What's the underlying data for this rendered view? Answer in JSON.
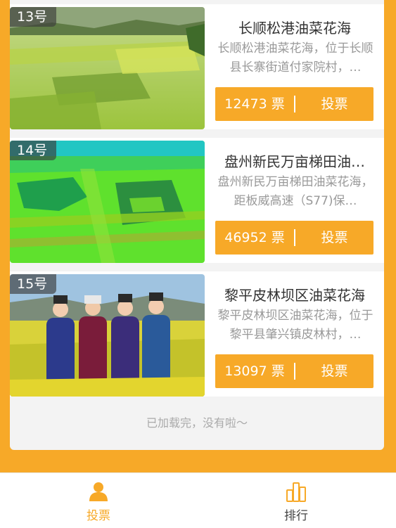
{
  "colors": {
    "accent": "#f7a928",
    "card": "#ffffff",
    "panel": "#f3f3f3",
    "muted": "#999999"
  },
  "items": [
    {
      "number": "13号",
      "title": "长顺松港油菜花海",
      "desc": "长顺松港油菜花海，位于长顺县长寨街道付家院村，…",
      "votes": "12473 票",
      "vote_label": "投票"
    },
    {
      "number": "14号",
      "title": "盘州新民万亩梯田油…",
      "desc": "盘州新民万亩梯田油菜花海，距板威高速（S77)保…",
      "votes": "46952 票",
      "vote_label": "投票"
    },
    {
      "number": "15号",
      "title": "黎平皮林坝区油菜花海",
      "desc": "黎平皮林坝区油菜花海，位于黎平县肇兴镇皮林村，…",
      "votes": "13097 票",
      "vote_label": "投票"
    }
  ],
  "list_end_text": "已加载完，没有啦～",
  "tabbar": {
    "vote": {
      "label": "投票",
      "icon": "person-icon",
      "active": true
    },
    "rank": {
      "label": "排行",
      "icon": "bar-chart-icon",
      "active": false
    }
  }
}
